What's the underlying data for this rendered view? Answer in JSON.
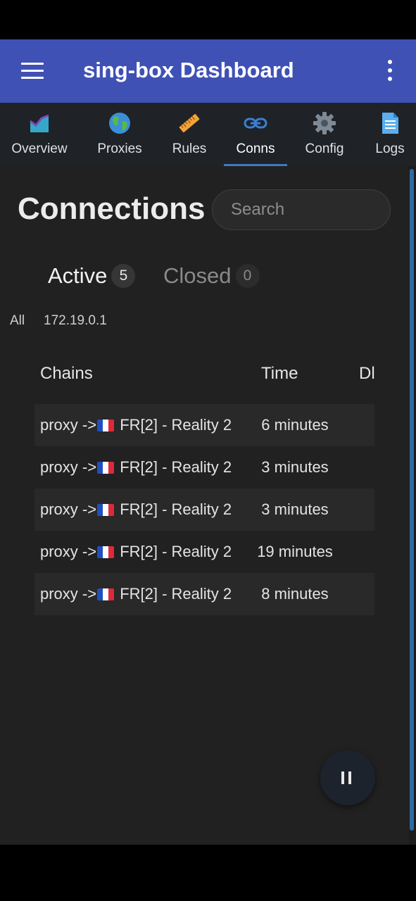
{
  "app_bar": {
    "title": "sing-box Dashboard"
  },
  "nav_tabs": [
    {
      "label": "Overview",
      "icon": "chart-area-icon"
    },
    {
      "label": "Proxies",
      "icon": "globe-icon"
    },
    {
      "label": "Rules",
      "icon": "ruler-icon"
    },
    {
      "label": "Conns",
      "icon": "link-icon",
      "active": true
    },
    {
      "label": "Config",
      "icon": "gear-icon"
    },
    {
      "label": "Logs",
      "icon": "document-icon"
    }
  ],
  "page": {
    "title": "Connections",
    "search_placeholder": "Search"
  },
  "filter_tabs": [
    {
      "label": "Active",
      "count": "5",
      "active": true
    },
    {
      "label": "Closed",
      "count": "0",
      "active": false
    }
  ],
  "source_filters": [
    "All",
    "172.19.0.1"
  ],
  "table": {
    "columns": [
      "Chains",
      "Time",
      "Dl"
    ],
    "rows": [
      {
        "chain_prefix": "proxy ->",
        "flag": "FR",
        "chain_suffix": " FR[2] - Reality 2",
        "time": "6 minutes"
      },
      {
        "chain_prefix": "proxy ->",
        "flag": "FR",
        "chain_suffix": " FR[2] - Reality 2",
        "time": "3 minutes"
      },
      {
        "chain_prefix": "proxy ->",
        "flag": "FR",
        "chain_suffix": " FR[2] - Reality 2",
        "time": "3 minutes"
      },
      {
        "chain_prefix": "proxy ->",
        "flag": "FR",
        "chain_suffix": " FR[2] - Reality 2",
        "time": "19 minutes"
      },
      {
        "chain_prefix": "proxy ->",
        "flag": "FR",
        "chain_suffix": " FR[2] - Reality 2",
        "time": "8 minutes"
      }
    ]
  },
  "fab": {
    "icon": "pause-icon"
  },
  "colors": {
    "app_bar": "#3f51b5",
    "tab_bar": "#1f2226",
    "background": "#212121",
    "accent": "#3d7bbf"
  }
}
